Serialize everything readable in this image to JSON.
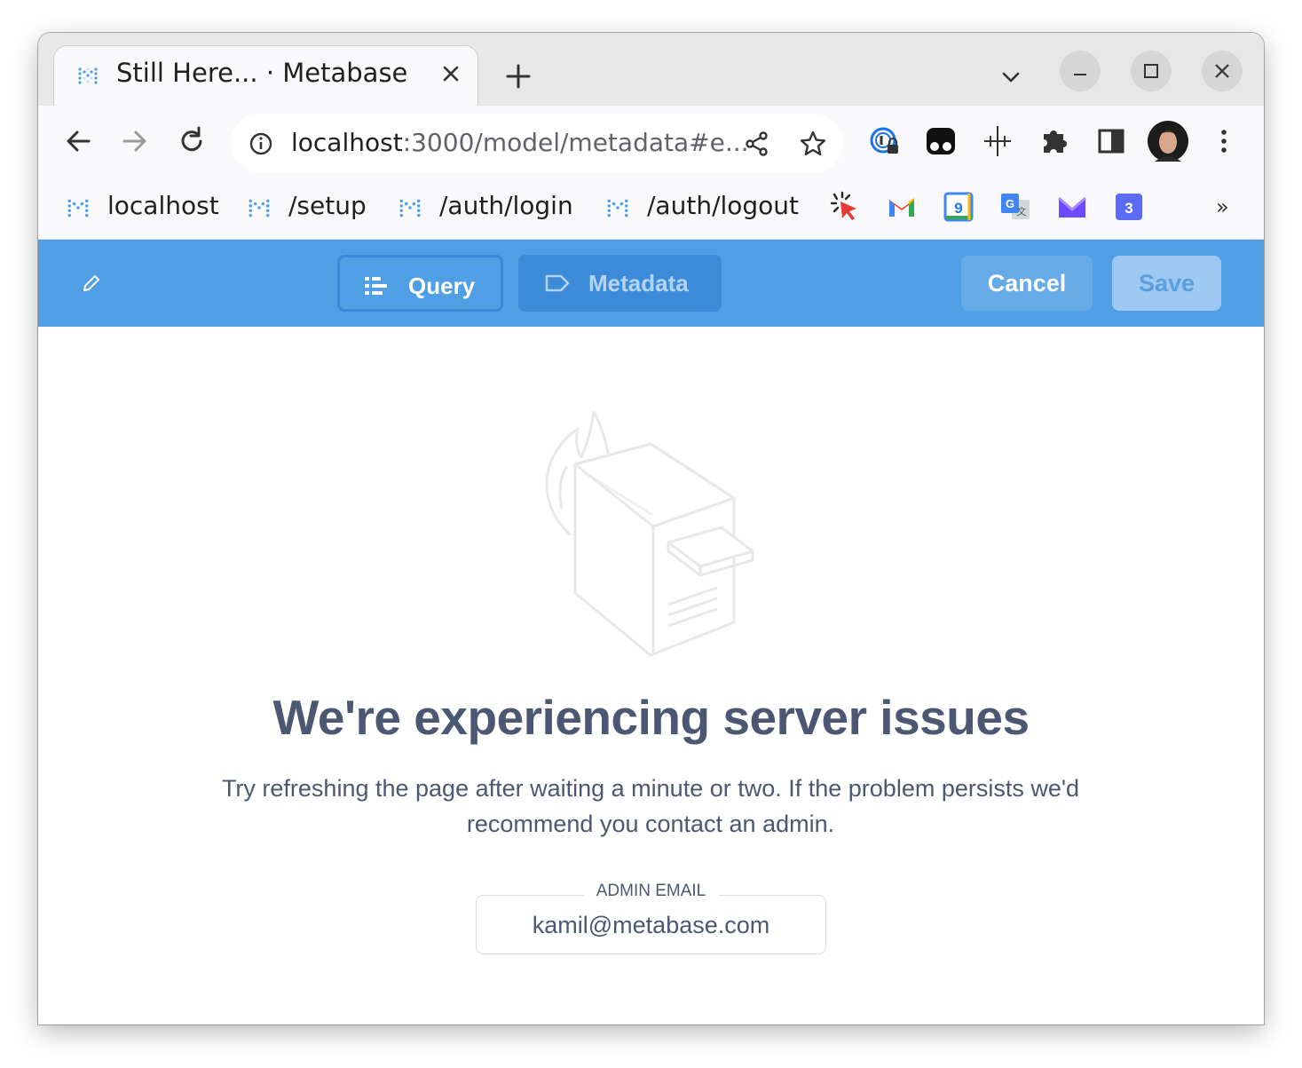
{
  "browser": {
    "tab": {
      "title": "Still Here... · Metabase",
      "favicon": "metabase-icon"
    },
    "url": {
      "host": "localhost",
      "rest": ":3000/model/metadata#e..."
    },
    "bookmarks": [
      {
        "label": "localhost",
        "icon": "metabase-icon"
      },
      {
        "label": "/setup",
        "icon": "metabase-icon"
      },
      {
        "label": "/auth/login",
        "icon": "metabase-icon"
      },
      {
        "label": "/auth/logout",
        "icon": "metabase-icon"
      }
    ],
    "bookmark_icons": [
      "cursor-click-icon",
      "gmail-icon",
      "calendar-icon",
      "translate-icon",
      "proton-mail-icon",
      "app-3-icon"
    ],
    "overflow_label": "»",
    "calendar_day": "9",
    "app_badge": "3"
  },
  "header": {
    "query_label": "Query",
    "metadata_label": "Metadata",
    "cancel_label": "Cancel",
    "save_label": "Save",
    "accent": "#509ee3"
  },
  "error": {
    "title": "We're experiencing server issues",
    "message": "Try refreshing the page after waiting a minute or two. If the problem persists we'd recommend you contact an admin.",
    "email_label": "ADMIN EMAIL",
    "email": "kamil@metabase.com"
  }
}
